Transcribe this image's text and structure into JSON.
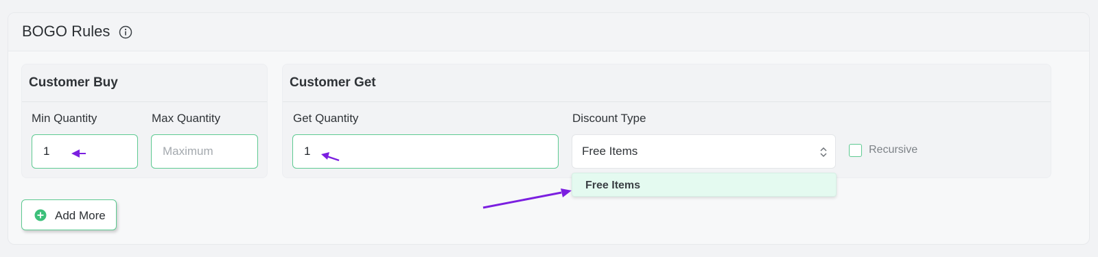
{
  "header": {
    "title": "BOGO Rules",
    "info_icon": "info-icon"
  },
  "customer_buy": {
    "title": "Customer Buy",
    "min_label": "Min Quantity",
    "min_value": "1",
    "max_label": "Max Quantity",
    "max_placeholder": "Maximum"
  },
  "customer_get": {
    "title": "Customer Get",
    "get_label": "Get Quantity",
    "get_value": "1",
    "discount_label": "Discount Type",
    "discount_value": "Free Items",
    "recursive_label": "Recursive",
    "recursive_checked": false
  },
  "dropdown": {
    "options": [
      "Free Items"
    ]
  },
  "add_more": {
    "label": "Add More",
    "icon": "plus-circle-icon"
  },
  "colors": {
    "accent": "#5cc990",
    "arrow": "#7b1fe0",
    "dropdown_highlight": "#e4faf0"
  }
}
